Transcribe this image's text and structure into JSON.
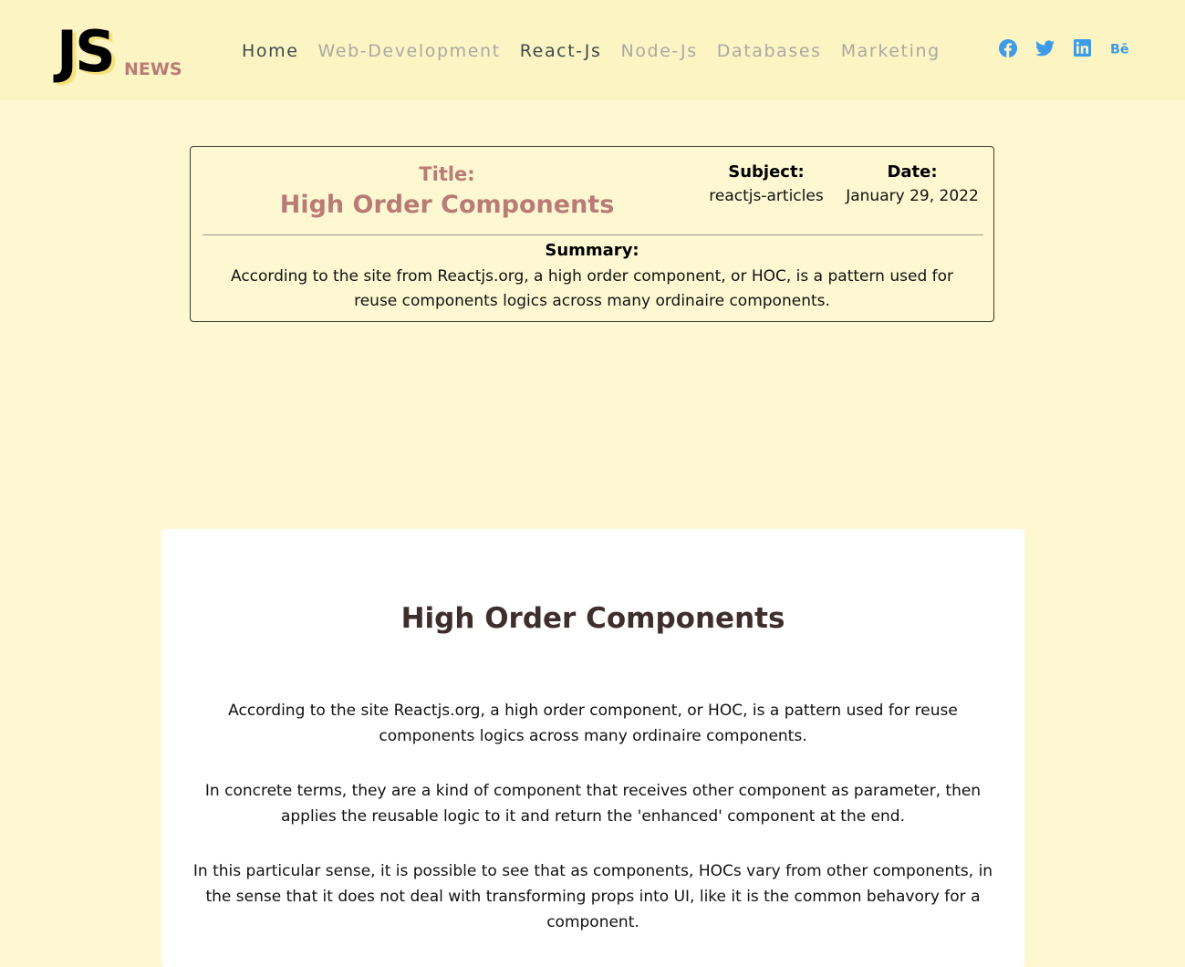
{
  "header": {
    "logo": {
      "main": "JS",
      "sub": "NEWS"
    },
    "nav": [
      {
        "label": "Home",
        "active": true
      },
      {
        "label": "Web-Development",
        "active": false
      },
      {
        "label": "React-Js",
        "active": true
      },
      {
        "label": "Node-Js",
        "active": false
      },
      {
        "label": "Databases",
        "active": false
      },
      {
        "label": "Marketing",
        "active": false
      }
    ],
    "social": [
      {
        "icon": "facebook-icon",
        "color": "#3d9be9"
      },
      {
        "icon": "twitter-icon",
        "color": "#3d9be9"
      },
      {
        "icon": "linkedin-icon",
        "color": "#3d9be9"
      },
      {
        "icon": "behance-icon",
        "color": "#3d9be9"
      }
    ]
  },
  "card": {
    "title_label": "Title:",
    "title": "High Order Components",
    "subject_label": "Subject:",
    "subject": "reactjs-articles",
    "date_label": "Date:",
    "date": "January 29, 2022",
    "summary_label": "Summary:",
    "summary": "According to the site from Reactjs.org, a high order component, or HOC, is a pattern used for reuse components logics across many ordinaire components."
  },
  "article": {
    "title": "High Order Components",
    "paragraphs": [
      "According to the site Reactjs.org, a high order component, or HOC, is a pattern used for reuse components logics across many ordinaire components.",
      "In concrete terms, they are a kind of component that receives other component as parameter, then applies the reusable logic to it and return the 'enhanced' component at the end.",
      "In this particular sense, it is possible to see that as components, HOCs vary from other components, in the sense that it does not deal with transforming props into UI, like it is the common behavory for a component."
    ]
  },
  "colors": {
    "background": "#fdf8d1",
    "header": "#fcf4c2",
    "accent": "#b97b76",
    "social": "#3d9be9",
    "nav_active": "#3e4a4c",
    "nav_inactive": "#a9a9a4"
  }
}
